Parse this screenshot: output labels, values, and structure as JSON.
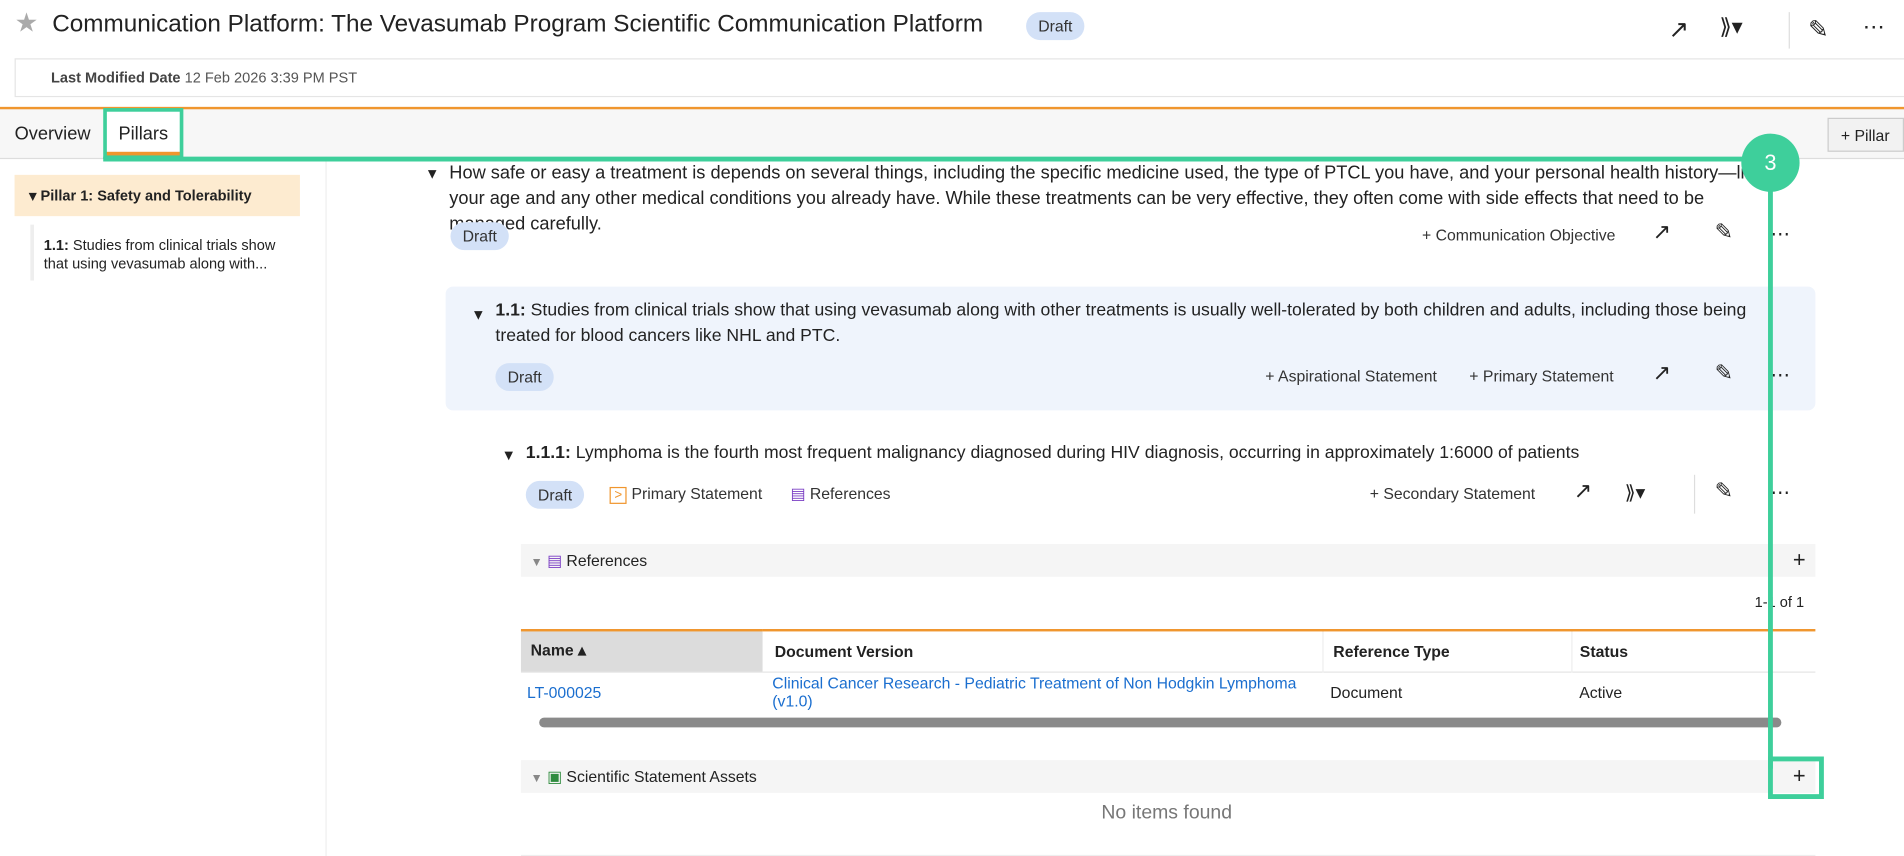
{
  "header": {
    "title": "Communication Platform: The Vevasumab Program Scientific Communication Platform",
    "status": "Draft",
    "last_modified_label": "Last Modified Date",
    "last_modified_value": "12 Feb 2026 3:39 PM PST"
  },
  "tabs": [
    {
      "label": "Overview"
    },
    {
      "label": "Pillars",
      "active": true
    }
  ],
  "add_pillar_label": "Pillar",
  "sidebar": {
    "pillar": "Pillar 1: Safety and Tolerability",
    "items": [
      {
        "num": "1.1:",
        "text": "Studies from clinical trials show that using vevasumab along with..."
      }
    ]
  },
  "pillar": {
    "text": "How safe or easy a treatment is depends on several things, including the specific medicine used, the type of PTCL you have, and your personal health history—like your age and any other medical conditions you already have. While these treatments can be very effective, they often come with side effects that need to be managed carefully.",
    "status": "Draft",
    "add_label": "Communication Objective"
  },
  "objective": {
    "num": "1.1:",
    "text": "Studies from clinical trials show that using vevasumab along with other treatments is usually well-tolerated by both children and adults, including those being treated for blood cancers like NHL and PTC.",
    "status": "Draft",
    "add1": "Aspirational Statement",
    "add2": "Primary Statement"
  },
  "statement": {
    "num": "1.1.1:",
    "text": "Lymphoma is the fourth most frequent malignancy diagnosed during HIV diagnosis, occurring in approximately 1:6000 of patients",
    "status": "Draft",
    "tag1": "Primary Statement",
    "tag2": "References",
    "add_label": "Secondary Statement"
  },
  "references": {
    "title": "References",
    "pagination": "1-1 of 1",
    "columns": [
      "Name",
      "Document Version",
      "Reference Type",
      "Status"
    ],
    "rows": [
      {
        "name": "LT-000025",
        "version": "Clinical Cancer Research - Pediatric Treatment of Non Hodgkin Lymphoma (v1.0)",
        "type": "Document",
        "status": "Active"
      }
    ]
  },
  "assets": {
    "title": "Scientific Statement Assets",
    "empty": "No items found"
  },
  "annotation": {
    "step": "3",
    "color": "#3ecf9b"
  },
  "colors": {
    "accent": "#f0962e",
    "link": "#1a6ecf"
  }
}
